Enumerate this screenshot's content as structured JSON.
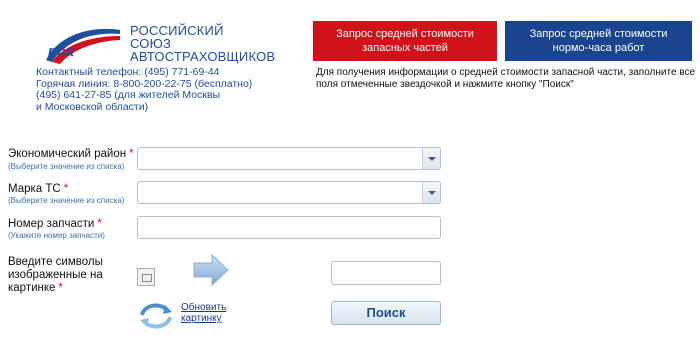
{
  "header": {
    "logo_text": "рса",
    "org_name_lines": [
      "РОССИЙСКИЙ",
      "СОЮЗ",
      "АВТОСТРАХОВЩИКОВ"
    ],
    "contacts": [
      "Контактный телефон:  (495) 771-69-44",
      "Горячая линия:  8-800-200-22-75  (бесплатно)",
      "(495) 641-27-85 (для жителей Москвы",
      "и Московской области)"
    ]
  },
  "tabs": [
    {
      "lines": [
        "Запрос средней стоимости",
        "запасных частей"
      ],
      "color": "#d2121b"
    },
    {
      "lines": [
        "Запрос средней стоимости",
        "нормо-часа работ"
      ],
      "color": "#1a4490"
    }
  ],
  "info_text": "Для получения информации о средней стоимости запасной части, заполните все поля отмеченные звездочкой и нажмите кнопку \"Поиск\"",
  "form": {
    "required_mark": "*",
    "economic_region": {
      "label": "Экономический район",
      "hint": "(Выберите значение из списка)",
      "value": ""
    },
    "vehicle_brand": {
      "label": "Марка ТС",
      "hint": "(Выберите значение из списка)",
      "value": ""
    },
    "part_number": {
      "label": "Номер запчасти",
      "hint": "(Укажите номер запчасти)",
      "value": ""
    },
    "captcha": {
      "label_lines": [
        "Введите символы",
        "изображенные на",
        "картинке"
      ],
      "value": ""
    },
    "refresh_lines": [
      "Обновить",
      "картинку"
    ],
    "search_button": "Поиск"
  }
}
